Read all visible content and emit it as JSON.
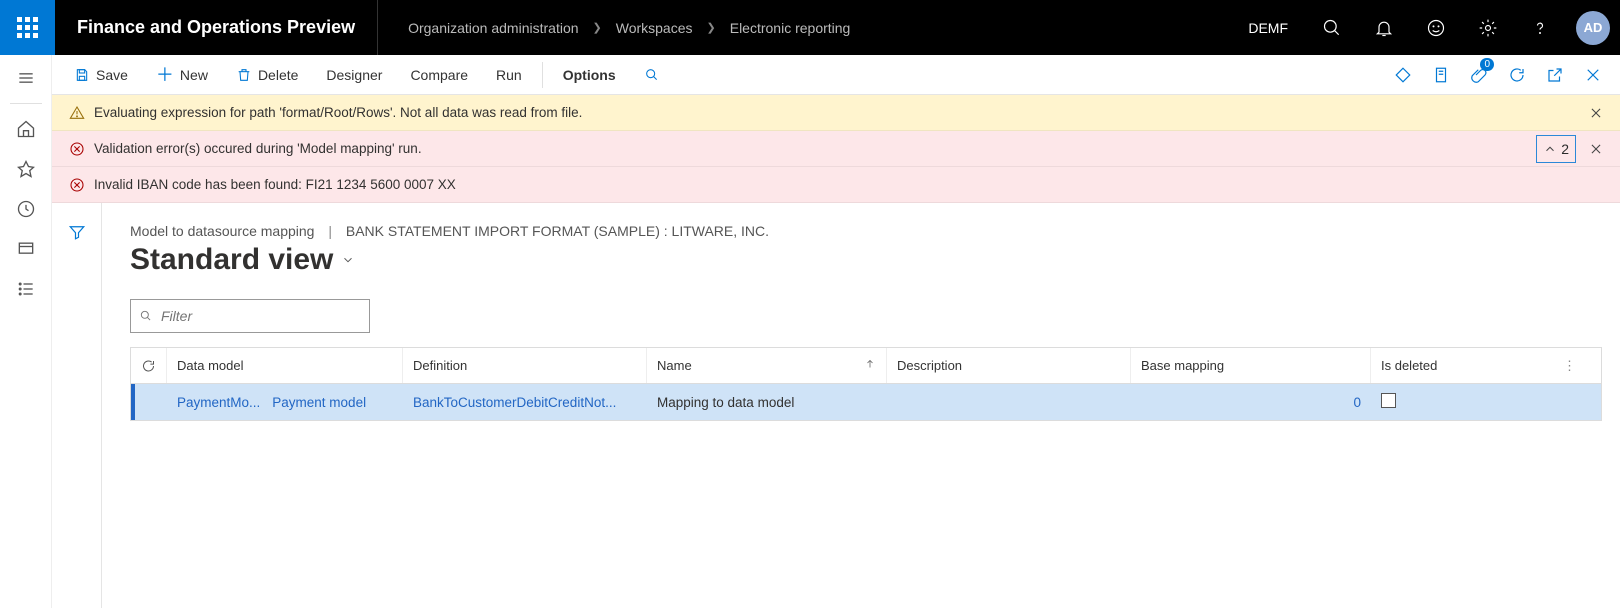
{
  "header": {
    "app_title": "Finance and Operations Preview",
    "breadcrumb": [
      "Organization administration",
      "Workspaces",
      "Electronic reporting"
    ],
    "company": "DEMF",
    "avatar": "AD"
  },
  "toolbar": {
    "save": "Save",
    "new": "New",
    "delete": "Delete",
    "designer": "Designer",
    "compare": "Compare",
    "run": "Run",
    "options": "Options",
    "attachments_badge": "0"
  },
  "messages": {
    "warn": "Evaluating expression for path 'format/Root/Rows'.  Not all data was read from file.",
    "error_summary": "Validation error(s) occured during 'Model mapping' run.",
    "error_count": "2",
    "error_detail": "Invalid IBAN code has been found: FI21 1234 5600 0007 XX"
  },
  "page": {
    "heading_left": "Model to datasource mapping",
    "heading_right": "BANK STATEMENT IMPORT FORMAT (SAMPLE) : LITWARE, INC.",
    "view": "Standard view"
  },
  "filter": {
    "placeholder": "Filter"
  },
  "grid": {
    "headers": {
      "data_model": "Data model",
      "definition": "Definition",
      "name": "Name",
      "description": "Description",
      "base_mapping": "Base mapping",
      "is_deleted": "Is deleted"
    },
    "row": {
      "data_model_short": "PaymentMo...",
      "data_model_long": "Payment model",
      "definition": "BankToCustomerDebitCreditNot...",
      "name": "Mapping to data model",
      "description": "",
      "base_mapping": "0",
      "is_deleted": false
    }
  }
}
